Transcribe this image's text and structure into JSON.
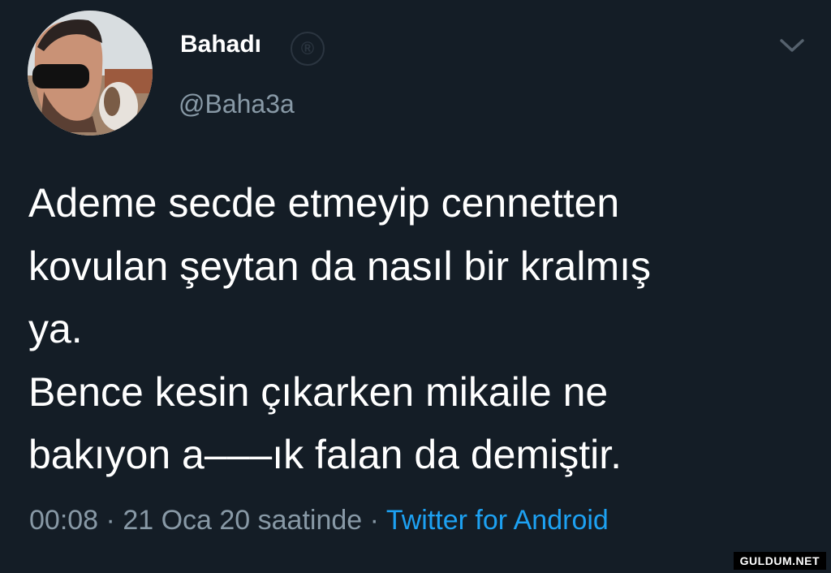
{
  "tweet": {
    "display_name": "Bahadı",
    "verified_glyph": "®",
    "handle": "@Baha3a",
    "text": "Ademe secde etmeyip cennetten\nkovulan şeytan da nasıl bir kralmış\nya.\nBence kesin çıkarken mikaile ne\nbakıyon a‒‒‒ık falan da demiştir.",
    "time": "00:08",
    "separator": " · ",
    "date": "21 Oca 20 saatinde",
    "source": "Twitter for Android"
  },
  "icons": {
    "avatar": "profile-photo",
    "menu": "chevron-down-icon"
  },
  "watermark": {
    "text": "GULDUM.NET"
  },
  "colors": {
    "background": "#141d26",
    "text": "#ffffff",
    "muted": "#8899a6",
    "link": "#1da1f2"
  }
}
